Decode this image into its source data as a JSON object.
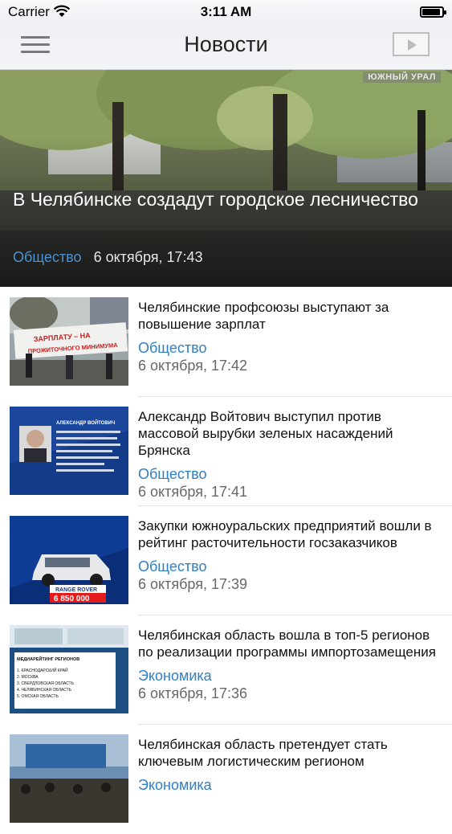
{
  "status_bar": {
    "carrier": "Carrier",
    "time": "3:11 AM",
    "battery_level": 1.0
  },
  "header": {
    "title": "Новости",
    "menu_icon": "hamburger-menu-icon",
    "video_icon": "video-play-icon"
  },
  "hero": {
    "title": "В Челябинске создадут городское лесничество",
    "category": "Общество",
    "date": "6 октября, 17:43",
    "watermark": "ЮЖНЫЙ УРАЛ"
  },
  "news": [
    {
      "headline": "Челябинские профсоюзы выступают за повышение зарплат",
      "category": "Общество",
      "date": "6 октября, 17:42",
      "thumb_text": [
        "ЗАРПЛАТУ – НА",
        "ПРОЖИТОЧНОГО МИНИМУМА"
      ]
    },
    {
      "headline": "Александр Войтович выступил против массовой вырубки зеленых насаждений Брянска",
      "category": "Общество",
      "date": "6 октября, 17:41",
      "thumb_text": [
        "АЛЕКСАНДР ВОЙТОВИЧ"
      ]
    },
    {
      "headline": "Закупки южноуральских предприятий вошли в рейтинг расточительности госзаказчиков",
      "category": "Общество",
      "date": "6 октября, 17:39",
      "thumb_text": [
        "RANGE ROVER",
        "6 850 000"
      ]
    },
    {
      "headline": "Челябинская область вошла в топ-5 регионов по реализации программы импортозамещения",
      "category": "Экономика",
      "date": "6 октября, 17:36",
      "thumb_text": [
        "МЕДИАРЕЙТИНГ РЕГИОНОВ",
        "1. КРАСНОДАРСКИЙ КРАЙ",
        "2. МОСКВА",
        "3. СВЕРДЛОВСКАЯ ОБЛАСТЬ",
        "4. ЧЕЛЯБИНСКАЯ ОБЛАСТЬ",
        "5. ОМСКАЯ ОБЛАСТЬ"
      ]
    },
    {
      "headline": "Челябинская область претендует стать ключевым логистическим регионом",
      "category": "Экономика",
      "date": "",
      "thumb_text": []
    }
  ],
  "colors": {
    "category_blue": "#2f7fc4",
    "hero_category": "#4a93d6"
  }
}
